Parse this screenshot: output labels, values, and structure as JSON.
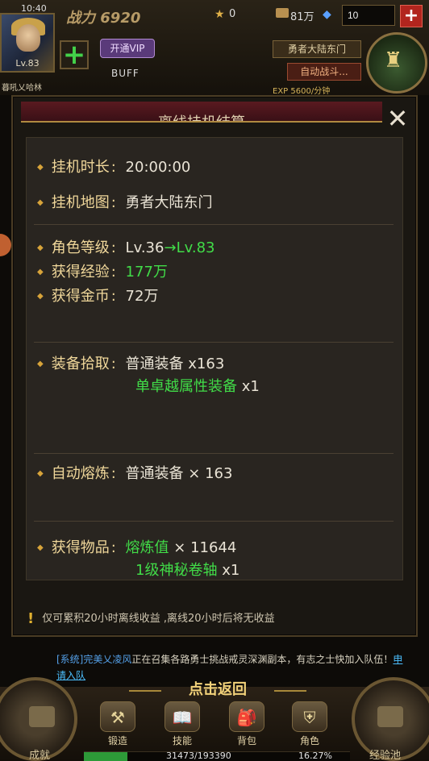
{
  "status_bar": {
    "time": "10:40"
  },
  "player": {
    "level": "Lv.83",
    "name": "暮吼乂哈林",
    "power": "战力 6920"
  },
  "currency": {
    "stars": "0",
    "gold": "81万",
    "gems_input": "10",
    "add_label": "+"
  },
  "hud": {
    "vip_label": "开通VIP",
    "buff_label": "BUFF",
    "map_label": "勇者大陆东门",
    "autofight_label": "自动战斗...",
    "exp_label": "EXP    5600/分钟"
  },
  "dialog": {
    "title": "离线挂机结算",
    "close_glyph": "✕",
    "rows": {
      "duration": {
        "label": "挂机时长",
        "value": "20:00:00"
      },
      "map": {
        "label": "挂机地图",
        "value": "勇者大陆东门"
      },
      "level": {
        "label": "角色等级",
        "from": "Lv.36",
        "arrow": "→",
        "to": "Lv.83"
      },
      "exp": {
        "label": "获得经验",
        "value": "177万"
      },
      "gold": {
        "label": "获得金币",
        "value": "72万"
      },
      "equip": {
        "label": "装备拾取",
        "item1": "普通装备",
        "count1": "x163",
        "item2": "单卓越属性装备",
        "count2": "x1"
      },
      "smelt": {
        "label": "自动熔炼",
        "item": "普通装备",
        "count": "×  163"
      },
      "items": {
        "label": "获得物品",
        "item1": "熔炼值",
        "count1": "×  11644",
        "item2": "1级神秘卷轴",
        "count2": "x1"
      }
    },
    "notice": "仅可累积20小时离线收益 ,离线20小时后将无收益"
  },
  "chat": {
    "system_tag": "[系统]",
    "sender": "完美乂凌风",
    "message": "正在召集各路勇士挑战戒灵深渊副本，有志之士快加入队伍！",
    "apply_link": "申请入队"
  },
  "bottom": {
    "return_label": "点击返回",
    "achievement_label": "成就",
    "pool_label": "经验池",
    "menu": [
      {
        "label": "锻造",
        "icon": "hammer-icon",
        "glyph": "⚒"
      },
      {
        "label": "技能",
        "icon": "book-icon",
        "glyph": "📖"
      },
      {
        "label": "背包",
        "icon": "backpack-icon",
        "glyph": "🎒"
      },
      {
        "label": "角色",
        "icon": "armor-icon",
        "glyph": "⛨"
      }
    ],
    "exp_progress_text": "31473/193390",
    "exp_percent_text": "16.27%",
    "exp_progress_fraction": 0.1627
  },
  "colors": {
    "accent_gold": "#f0d79a",
    "green": "#41dc48",
    "close_red": "#b2251e"
  }
}
